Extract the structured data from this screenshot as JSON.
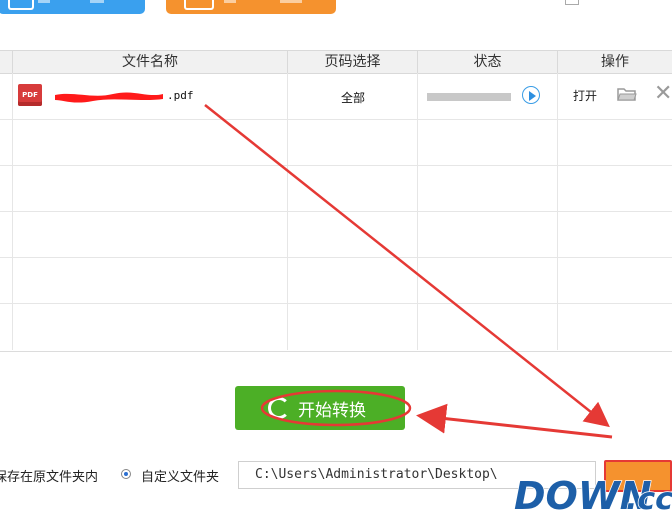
{
  "table": {
    "headers": [
      "文件名称",
      "页码选择",
      "状态",
      "操作"
    ],
    "rows": [
      {
        "file_icon": "PDF",
        "file_name_suffix": ".pdf",
        "pages": "全部",
        "action_open": "打开"
      }
    ]
  },
  "bottom": {
    "start_label": "开始转换",
    "save_original_label": "保存在原文件夹内",
    "custom_folder_label": "自定义文件夹",
    "path_value": "C:\\Users\\Administrator\\Desktop\\"
  },
  "watermark": {
    "text_main": "DOWN",
    "text_suffix": ".cc"
  },
  "colors": {
    "green": "#4caf26",
    "orange": "#f5922e",
    "blue": "#3aa0ee",
    "annotation_red": "#e53935"
  },
  "icons": [
    "add-file-icon",
    "add-folder-icon",
    "clear-list-icon",
    "pdf-icon",
    "play-icon",
    "folder-open-icon",
    "close-icon",
    "refresh-icon"
  ]
}
